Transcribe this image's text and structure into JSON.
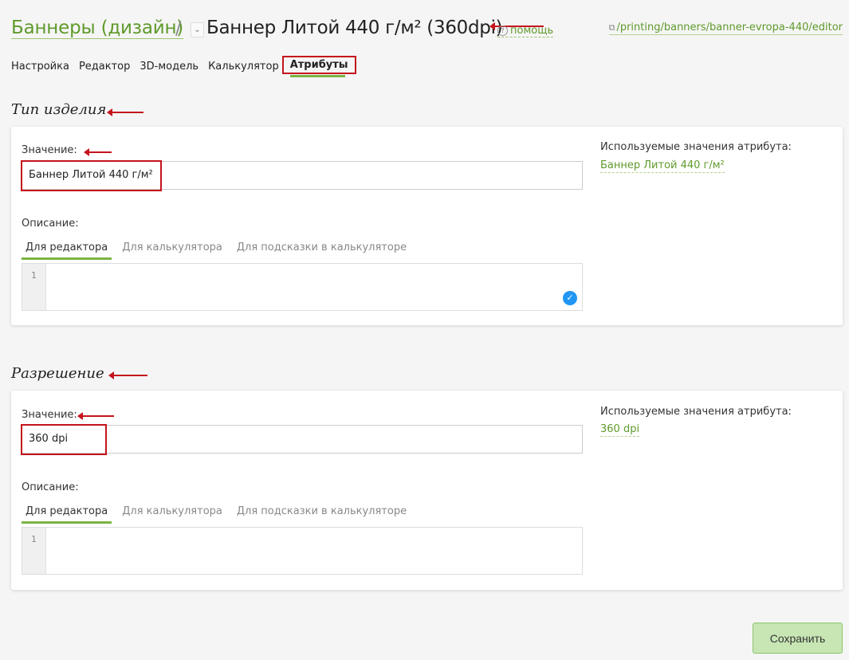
{
  "header": {
    "parent_link": "Баннеры (дизайн)",
    "separator": "/",
    "dropdown_glyph": "⌄",
    "title": "Баннер Литой 440 г/м² (360dpi)",
    "help_label": "помощь",
    "help_icon": "?",
    "url_icon": "⧉",
    "url": "/printing/banners/banner-evropa-440/editor"
  },
  "tabs": [
    "Настройка",
    "Редактор",
    "3D-модель",
    "Калькулятор",
    "Атрибуты"
  ],
  "active_tab": "Атрибуты",
  "sections": [
    {
      "title": "Тип изделия",
      "value_label": "Значение:",
      "value": "Баннер Литой 440 г/м²",
      "description_label": "Описание:",
      "desc_tabs": [
        "Для редактора",
        "Для калькулятора",
        "Для подсказки в калькуляторе"
      ],
      "line_number": "1",
      "used_label": "Используемые значения атрибута:",
      "used_value": "Баннер Литой 440 г/м²",
      "check_glyph": "✓"
    },
    {
      "title": "Разрешение",
      "value_label": "Значение:",
      "value": "360 dpi",
      "description_label": "Описание:",
      "desc_tabs": [
        "Для редактора",
        "Для калькулятора",
        "Для подсказки в калькуляторе"
      ],
      "line_number": "1",
      "used_label": "Используемые значения атрибута:",
      "used_value": "360 dpi"
    }
  ],
  "save_label": "Сохранить",
  "colors": {
    "accent": "#7cb342",
    "link": "#5f9a2c",
    "annotation": "#c4141d",
    "save_bg": "#c8e6b4"
  }
}
